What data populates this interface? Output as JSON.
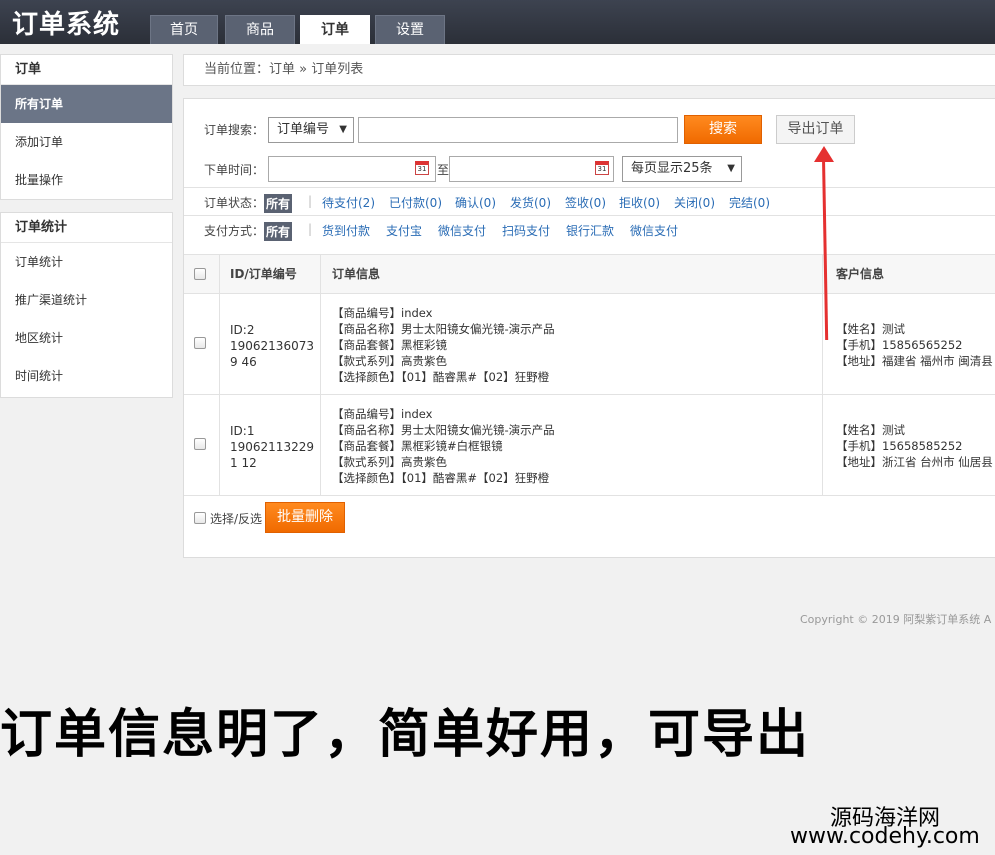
{
  "app": {
    "title": "订单系统"
  },
  "nav": {
    "tabs": [
      "首页",
      "商品",
      "订单",
      "设置"
    ],
    "active": 2
  },
  "sidebar": {
    "order_group": {
      "title": "订单",
      "items": [
        "所有订单",
        "添加订单",
        "批量操作"
      ]
    },
    "stats_group": {
      "title": "订单统计",
      "items": [
        "订单统计",
        "推广渠道统计",
        "地区统计",
        "时间统计"
      ]
    }
  },
  "breadcrumb": {
    "text": "当前位置：订单 » 订单列表"
  },
  "search": {
    "label": "订单搜索：",
    "field_select": "订单编号",
    "keyword_value": "",
    "search_button": "搜索",
    "export_button": "导出订单",
    "time_label": "下单时间：",
    "time_sep": "至",
    "time_start": "",
    "time_end": "",
    "page_size_select": "每页显示25条"
  },
  "filters": {
    "status_label": "订单状态：",
    "status_all": "所有",
    "statuses": [
      "待支付(2)",
      "已付款(0)",
      "确认(0)",
      "发货(0)",
      "签收(0)",
      "拒收(0)",
      "关闭(0)",
      "完结(0)"
    ],
    "payment_label": "支付方式：",
    "payment_all": "所有",
    "payments": [
      "货到付款",
      "支付宝",
      "微信支付",
      "扫码支付",
      "银行汇款",
      "微信支付"
    ]
  },
  "table": {
    "headers": {
      "id": "ID/订单编号",
      "info": "订单信息",
      "customer": "客户信息"
    },
    "rows": [
      {
        "id": "ID:2",
        "order_no": "190621360739 46",
        "info": [
          "【商品编号】index",
          "【商品名称】男士太阳镜女偏光镜-演示产品",
          "【商品套餐】黑框彩镜",
          "【款式系列】高贵紫色",
          "【选择颜色】【01】酷睿黑#【02】狂野橙"
        ],
        "customer": [
          "【姓名】测试",
          "【手机】15856565252",
          "【地址】福建省 福州市 闽清县"
        ]
      },
      {
        "id": "ID:1",
        "order_no": "190621132291 12",
        "info": [
          "【商品编号】index",
          "【商品名称】男士太阳镜女偏光镜-演示产品",
          "【商品套餐】黑框彩镜#白框银镜",
          "【款式系列】高贵紫色",
          "【选择颜色】【01】酷睿黑#【02】狂野橙"
        ],
        "customer": [
          "【姓名】测试",
          "【手机】15658585252",
          "【地址】浙江省 台州市 仙居县"
        ]
      }
    ]
  },
  "footer_actions": {
    "select_toggle": "选择/反选",
    "batch_delete": "批量删除"
  },
  "copyright": "Copyright © 2019 阿梨紫订单系统 A",
  "promo_text": "订单信息明了，简单好用，可导出",
  "watermark": {
    "line1": "源码海洋网",
    "line2": "www.codehy.com"
  },
  "colors": {
    "topbar": "#2f343f",
    "accent_orange": "#f57c00",
    "active_side": "#6b7587",
    "link": "#2a6cb5",
    "arrow": "#e53030"
  }
}
